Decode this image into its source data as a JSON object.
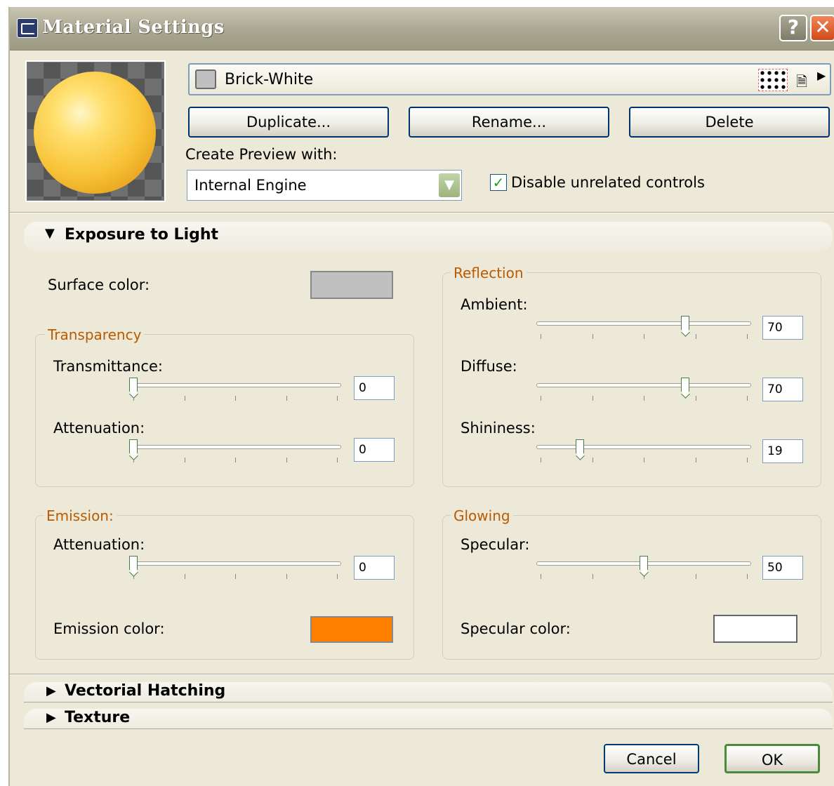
{
  "window": {
    "title": "Material Settings",
    "help": "?",
    "close": "✕"
  },
  "material": {
    "name": "Brick-White",
    "swatch_color": "#c0c0c0"
  },
  "buttons": {
    "duplicate": "Duplicate...",
    "rename": "Rename...",
    "delete": "Delete",
    "cancel": "Cancel",
    "ok": "OK"
  },
  "preview": {
    "label": "Create Preview with:",
    "engine": "Internal Engine"
  },
  "disable_unrelated": {
    "label": "Disable unrelated controls",
    "checked": true
  },
  "sections": {
    "exposure": {
      "title": "Exposure to Light",
      "expanded": true
    },
    "hatching": {
      "title": "Vectorial Hatching",
      "expanded": false
    },
    "texture": {
      "title": "Texture",
      "expanded": false
    }
  },
  "surface_color": {
    "label": "Surface color:",
    "color": "#c0c0c0"
  },
  "transparency": {
    "title": "Transparency",
    "transmittance": {
      "label": "Transmittance:",
      "value": "0",
      "level": 0
    },
    "attenuation": {
      "label": "Attenuation:",
      "value": "0",
      "level": 0
    }
  },
  "reflection": {
    "title": "Reflection",
    "ambient": {
      "label": "Ambient:",
      "value": "70",
      "level": 70
    },
    "diffuse": {
      "label": "Diffuse:",
      "value": "70",
      "level": 70
    },
    "shininess": {
      "label": "Shininess:",
      "value": "19",
      "level": 19
    }
  },
  "emission": {
    "title": "Emission:",
    "attenuation": {
      "label": "Attenuation:",
      "value": "0",
      "level": 0
    },
    "color_label": "Emission color:",
    "color": "#ff8000"
  },
  "glowing": {
    "title": "Glowing",
    "specular": {
      "label": "Specular:",
      "value": "50",
      "level": 50
    },
    "color_label": "Specular color:",
    "color": "#ffffff"
  },
  "icons": [
    "material-app-icon",
    "help-icon",
    "close-icon",
    "pattern-icon",
    "document-icon",
    "menu-arrow-icon",
    "dropdown-icon",
    "check-icon",
    "triangle-expanded-icon",
    "triangle-collapsed-icon"
  ]
}
